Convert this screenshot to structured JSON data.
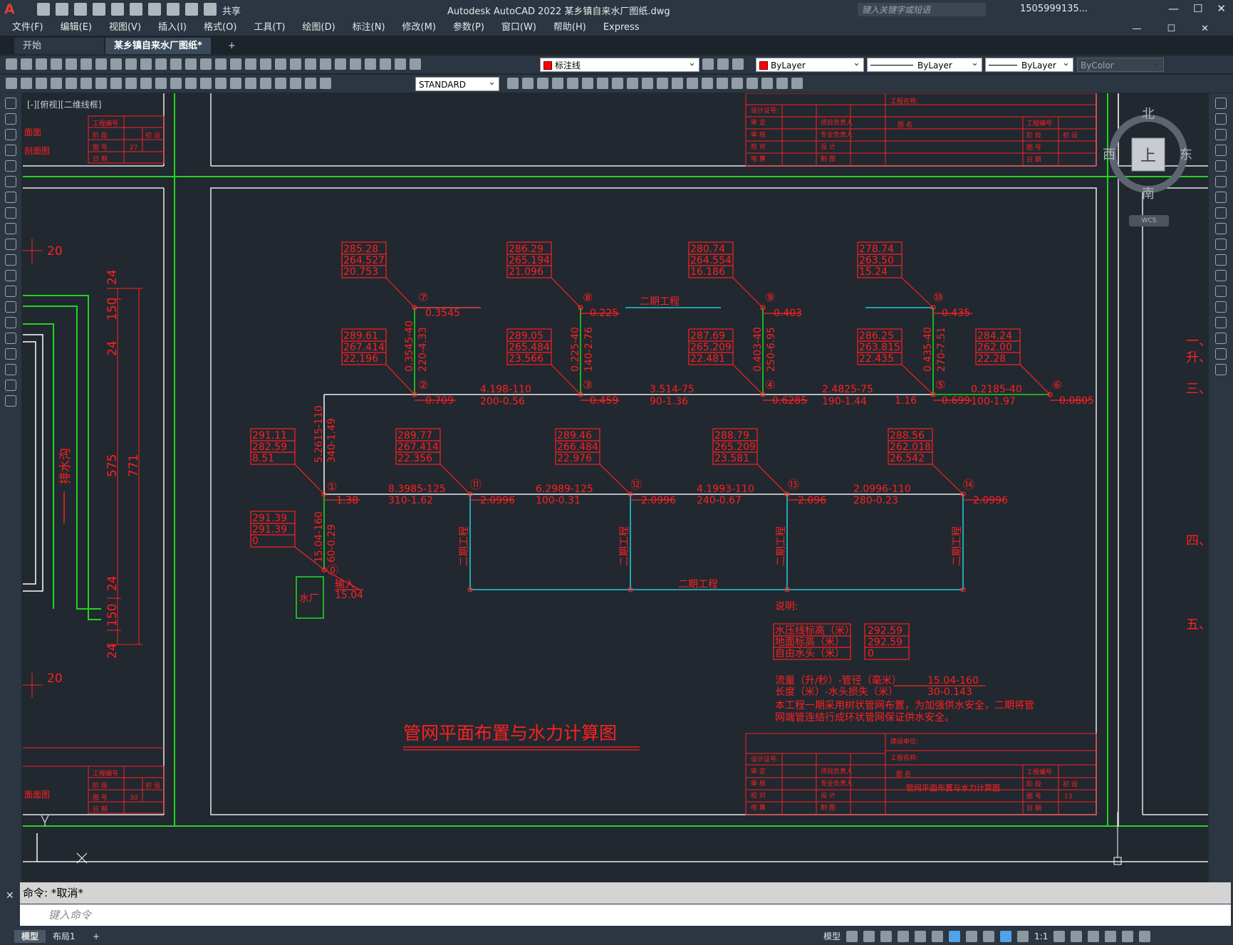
{
  "app": {
    "logo_letter": "A",
    "share": "共享",
    "title": "Autodesk AutoCAD 2022   某乡镇自来水厂图纸.dwg",
    "search_placeholder": "键入关键字或短语",
    "user": "1505999135...",
    "win_minimize": "—",
    "win_maximize": "☐",
    "win_close": "✕"
  },
  "menu": {
    "items": [
      "文件(F)",
      "编辑(E)",
      "视图(V)",
      "插入(I)",
      "格式(O)",
      "工具(T)",
      "绘图(D)",
      "标注(N)",
      "修改(M)",
      "参数(P)",
      "窗口(W)",
      "帮助(H)",
      "Express"
    ]
  },
  "tabs": {
    "start": "开始",
    "doc": "某乡镇自来水厂图纸*",
    "close": "✕",
    "add": "+"
  },
  "toolbar": {
    "layer": "标注线",
    "color": "ByLayer",
    "linetype": "ByLayer",
    "lineweight": "ByLayer",
    "plotstyle": "ByColor",
    "textstyle": "STANDARD"
  },
  "viewport": {
    "label": "[-][俯视][二维线框]",
    "compass": {
      "n": "北",
      "s": "南",
      "e": "东",
      "w": "西",
      "center": "上",
      "wcs": "WCS"
    }
  },
  "drawing": {
    "title": "管网平面布置与水力计算图",
    "plant_label": "水厂",
    "input_label": "输入",
    "input_value": "15.04",
    "phase2": "二期工程",
    "left_labels": {
      "drain": "排水沟",
      "dim20a": "20",
      "dim20b": "20",
      "d24a": "24",
      "d150a": "150",
      "d24b": "24",
      "d575": "575",
      "d771": "771",
      "d24c": "24",
      "d150b": "150",
      "d24d": "24"
    },
    "left_side": {
      "a": "面面",
      "b": "剖面图",
      "c": "面面图"
    },
    "right_side": {
      "a": "一、",
      "b": "升、",
      "c": "三、",
      "d": "四、",
      "e": "五、"
    },
    "nodes_top": [
      {
        "n": "⑦",
        "v1": "285.28",
        "v2": "264.527",
        "v3": "20.753",
        "h": "0.3545",
        "pipe": "0.3545-40",
        "pipe2": "220-4.33"
      },
      {
        "n": "⑧",
        "v1": "286.29",
        "v2": "265.194",
        "v3": "21.096",
        "h": "0.225",
        "pipe": "0.225-40",
        "pipe2": "140-2.76"
      },
      {
        "n": "⑨",
        "v1": "280.74",
        "v2": "264.554",
        "v3": "16.186",
        "h": "0.403",
        "pipe": "0.403-40",
        "pipe2": "250-6.95"
      },
      {
        "n": "⑩",
        "v1": "278.74",
        "v2": "263.50",
        "v3": "15.24",
        "h": "0.435",
        "pipe": "0.435-40",
        "pipe2": "270-7.51"
      }
    ],
    "nodes_mid": [
      {
        "n": "②",
        "v1": "289.61",
        "v2": "267.414",
        "v3": "22.196",
        "h": "0.709"
      },
      {
        "n": "③",
        "v1": "289.05",
        "v2": "265.484",
        "v3": "23.566",
        "h": "0.459"
      },
      {
        "n": "④",
        "v1": "287.69",
        "v2": "265.209",
        "v3": "22.481",
        "h": "0.6285"
      },
      {
        "n": "⑤",
        "v1": "286.25",
        "v2": "263.815",
        "v3": "22.435",
        "h": "0.699",
        "extra": "1.16"
      },
      {
        "n": "⑥",
        "v1": "284.24",
        "v2": "262.00",
        "v3": "22.28",
        "h": "0.0805"
      }
    ],
    "mid_pipes": [
      {
        "a": "4.198-110",
        "b": "200-0.56"
      },
      {
        "a": "3.514-75",
        "b": "90-1.36"
      },
      {
        "a": "2.4825-75",
        "b": "190-1.44"
      },
      {
        "a": "0.2185-40",
        "b": "100-1.97"
      }
    ],
    "riser": {
      "a": "5.2615-110",
      "b": "340-1.49"
    },
    "nodes_low": [
      {
        "n": "①",
        "v1": "291.11",
        "v2": "282.59",
        "v3": "8.51",
        "h": "1.38"
      },
      {
        "n": "⑪",
        "v1": "289.77",
        "v2": "267.414",
        "v3": "22.356",
        "h": "2.0996"
      },
      {
        "n": "⑫",
        "v1": "289.46",
        "v2": "266.484",
        "v3": "22.976",
        "h": "2.0996"
      },
      {
        "n": "⑬",
        "v1": "288.79",
        "v2": "265.209",
        "v3": "23.581",
        "h": "2.096"
      },
      {
        "n": "⑭",
        "v1": "288.56",
        "v2": "262.018",
        "v3": "26.542",
        "h": "2.0996"
      }
    ],
    "low_pipes": [
      {
        "a": "8.3985-125",
        "b": "310-1.62"
      },
      {
        "a": "6.2989-125",
        "b": "100-0.31"
      },
      {
        "a": "4.1993-110",
        "b": "240-0.67"
      },
      {
        "a": "2.0996-110",
        "b": "280-0.23"
      }
    ],
    "node0": {
      "n": "⓪",
      "v1": "291.39",
      "v2": "291.39",
      "v3": "0",
      "pipe": "15.04-160",
      "pipe2": "60-0.29"
    },
    "legend": {
      "title": "说明:",
      "row1": "水压线标高（米）",
      "row2": "地面标高（米）",
      "row3": "自由水头（米）",
      "v1": "292.59",
      "v2": "292.59",
      "v3": "0",
      "flow1": "流量（升/秒）-管径（毫米）",
      "flow2": "长度（米）-水头损失（米）",
      "fv1": "15.04-160",
      "fv2": "30-0.143",
      "note1": "本工程一期采用树状管网布置，为加强供水安全，二期将管",
      "note2": "网端管连结行成环状管网保证供水安全。"
    },
    "titleblock": {
      "build_unit": "建设单位:",
      "project": "工程名称:",
      "drawing_name": "图  名",
      "name_value": "管网平面布置与水力计算图",
      "cert": "设计证号:",
      "approve": "审   定",
      "review": "审   核",
      "check": "校   对",
      "design": "设   计",
      "draw": "制   图",
      "calc": "电   算",
      "leader": "项目负责人",
      "spec": "专业负责人",
      "proj_no": "工程编号",
      "phase": "阶   段",
      "sheet": "图   号",
      "date": "日   期",
      "design_s": "初   设",
      "sheet_no": "13",
      "sheet_no_left": "30",
      "sheet_no_lt": "27"
    }
  },
  "command": {
    "history": "命令: *取消*",
    "placeholder": "键入命令"
  },
  "status": {
    "model_tab": "模型",
    "layout_tab": "布局1",
    "add": "+",
    "model_btn": "模型",
    "scale": "1:1"
  }
}
